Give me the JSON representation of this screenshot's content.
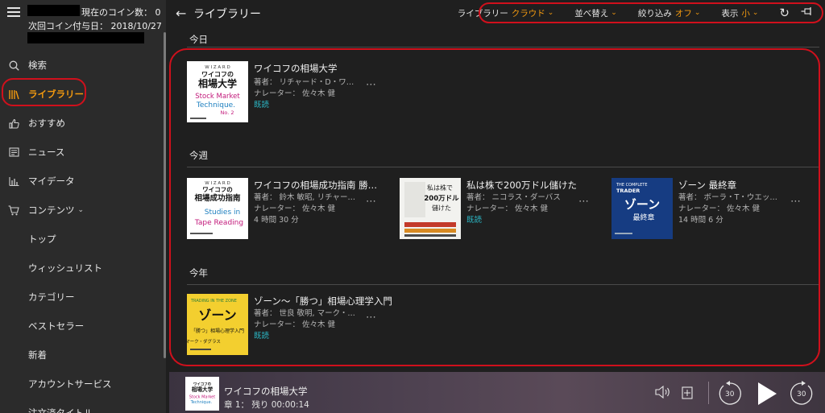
{
  "sidebar": {
    "coin_label": "現在のコイン数：",
    "coin_value": "0",
    "next_coin_label": "次回コイン付与日：",
    "next_coin_date": "2018/10/27",
    "items": [
      {
        "label": "検索",
        "icon": "search-icon"
      },
      {
        "label": "ライブラリー",
        "icon": "library-icon"
      },
      {
        "label": "おすすめ",
        "icon": "thumbs-up-icon"
      },
      {
        "label": "ニュース",
        "icon": "news-icon"
      },
      {
        "label": "マイデータ",
        "icon": "bar-chart-icon"
      },
      {
        "label": "コンテンツ",
        "icon": "cart-icon"
      }
    ],
    "sub_items": [
      "トップ",
      "ウィッシュリスト",
      "カテゴリー",
      "ベストセラー",
      "新着",
      "アカウントサービス",
      "注文済タイトル"
    ]
  },
  "header": {
    "title": "ライブラリー",
    "toolbar": {
      "library_label": "ライブラリー",
      "library_value": "クラウド",
      "sort_label": "並べ替え",
      "filter_label": "絞り込み",
      "filter_value": "オフ",
      "view_label": "表示",
      "view_value": "小"
    }
  },
  "sections": {
    "today": {
      "title": "今日",
      "books": [
        {
          "title": "ワイコフの相場大学",
          "author": "著者： リチャード・D・ワイコフ, 鈴...",
          "narrator": "ナレーター： 佐々木 健",
          "status": "既読"
        }
      ]
    },
    "week": {
      "title": "今週",
      "books": [
        {
          "title": "ワイコフの相場成功指南 勝つた...",
          "author": "著者： 鈴木 敏昭, リチャード・...",
          "narrator": "ナレーター： 佐々木 健",
          "duration": "4 時間 30 分"
        },
        {
          "title": "私は株で200万ドル儲けた",
          "author": "著者： ニコラス・ダーバス",
          "narrator": "ナレーター： 佐々木 健",
          "status": "既読"
        },
        {
          "title": "ゾーン 最終章",
          "author": "著者： ボーラ・T・ウエッブ, マー...",
          "narrator": "ナレーター： 佐々木 健",
          "duration": "14 時間 6 分"
        }
      ]
    },
    "year": {
      "title": "今年",
      "books": [
        {
          "title": "ゾーン～「勝つ」相場心理学入門",
          "author": "著者： 世良 敬明, マーク・ダグ...",
          "narrator": "ナレーター： 佐々木 健",
          "status": "既読"
        }
      ]
    }
  },
  "covers": {
    "wyckoff_univ": {
      "top": "W I Z A R D",
      "jp": "ワイコフの",
      "jp2": "相場大学",
      "en1": "Stock Market",
      "en2": "Technique.",
      "no": "No. 2"
    },
    "wyckoff_success": {
      "top": "W I Z A R D",
      "jp": "ワイコフの",
      "jp2": "相場成功指南",
      "en1": "Studies in",
      "en2": "Tape Reading"
    },
    "darvas": {
      "jp1": "私は株で",
      "jp2": "200万ドル",
      "jp3": "儲けた"
    },
    "zone_final": {
      "en1": "THE COMPLETE",
      "en2": "TRADER",
      "jp1": "ゾーン",
      "jp2": "最終章"
    },
    "zone": {
      "en1": "TRADING IN THE ZONE",
      "jp1": "ゾーン",
      "jp2": "「勝つ」相場心理学入門",
      "author": "マーク・ダグラス"
    }
  },
  "player": {
    "title": "ワイコフの相場大学",
    "chapter": "章 1：  残り 00:00:14",
    "skip_back": "30",
    "skip_fwd": "30"
  },
  "colors": {
    "accent": "#f39a0f",
    "status": "#2bb8c6",
    "highlight": "#d0101c"
  }
}
